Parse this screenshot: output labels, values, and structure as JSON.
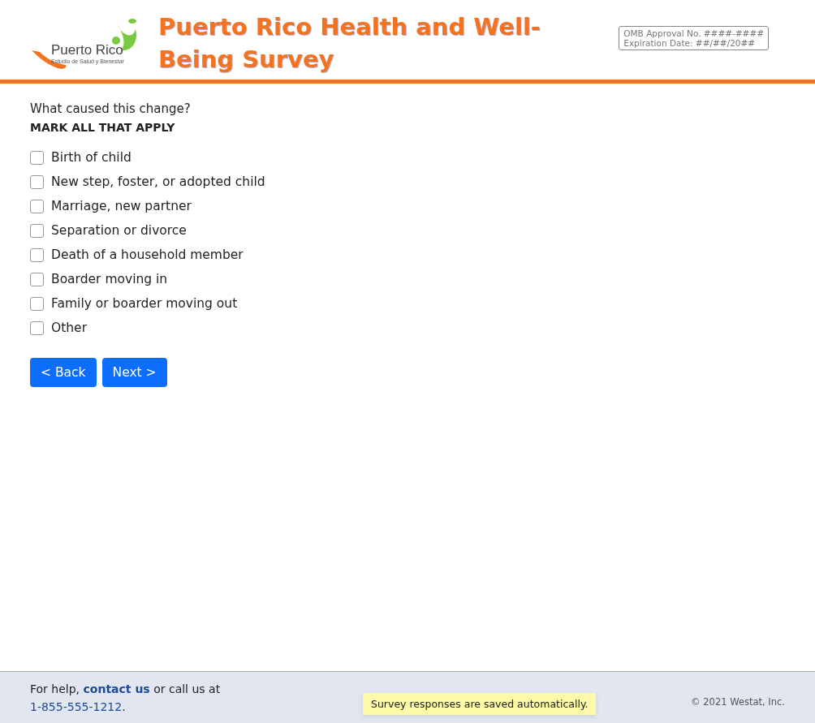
{
  "header": {
    "logo_name": "Puerto Rico",
    "logo_tagline": "Estudio de Salud y Bienestar",
    "title": "Puerto Rico Health and Well-Being Survey",
    "omb_lines": [
      "OMB Approval No. ####-####",
      "Expiration Date: ##/##/20##"
    ]
  },
  "question": {
    "text": "What caused this change?",
    "instruction": "MARK ALL THAT APPLY"
  },
  "options": [
    {
      "label": "Birth of child",
      "checked": false
    },
    {
      "label": "New step, foster, or adopted child",
      "checked": false
    },
    {
      "label": "Marriage, new partner",
      "checked": false
    },
    {
      "label": "Separation or divorce",
      "checked": false
    },
    {
      "label": "Death of a household member",
      "checked": false
    },
    {
      "label": "Boarder moving in",
      "checked": false
    },
    {
      "label": "Family or boarder moving out",
      "checked": false
    },
    {
      "label": "Other",
      "checked": false
    }
  ],
  "buttons": [
    "< Back",
    "Next >"
  ],
  "footer": {
    "help_before": "For help,",
    "help_link": "contact us",
    "help_after": "or call us at",
    "phone": "1-855-555-1212",
    "help_end": ".",
    "notice": "Survey responses are saved automatically.",
    "copyright": "© 2021 Westat, Inc."
  }
}
